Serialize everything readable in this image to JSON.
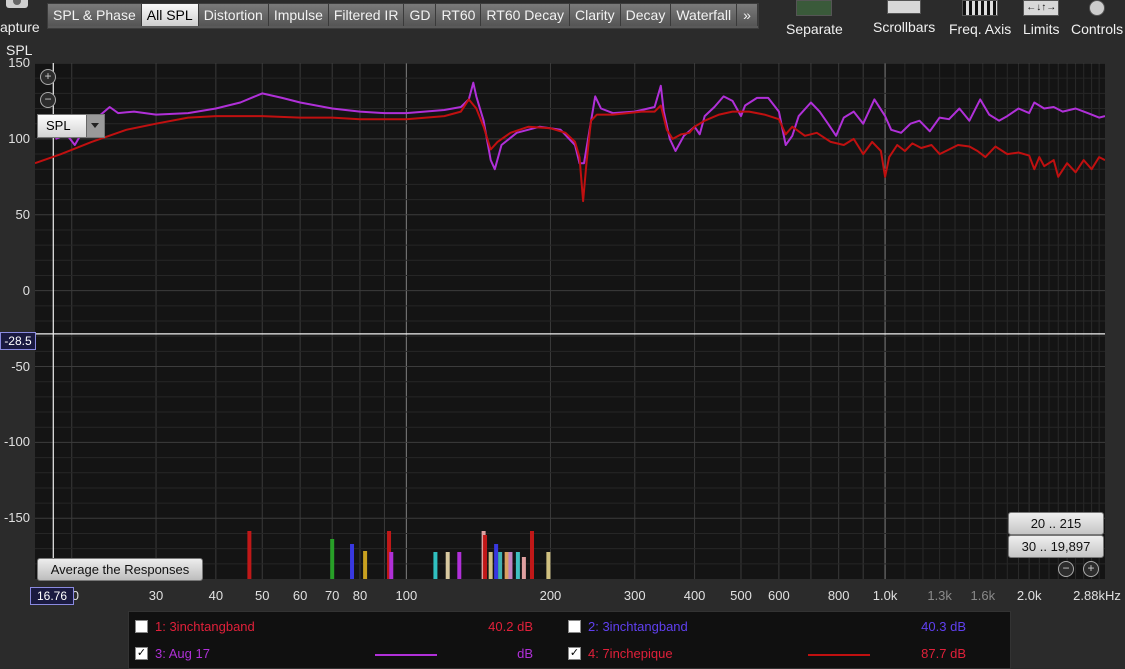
{
  "capture": {
    "label": "apture"
  },
  "tabs": [
    {
      "label": "SPL & Phase",
      "active": false
    },
    {
      "label": "All SPL",
      "active": true
    },
    {
      "label": "Distortion",
      "active": false
    },
    {
      "label": "Impulse",
      "active": false
    },
    {
      "label": "Filtered IR",
      "active": false
    },
    {
      "label": "GD",
      "active": false
    },
    {
      "label": "RT60",
      "active": false
    },
    {
      "label": "RT60 Decay",
      "active": false
    },
    {
      "label": "Clarity",
      "active": false
    },
    {
      "label": "Decay",
      "active": false
    },
    {
      "label": "Waterfall",
      "active": false
    },
    {
      "label": "»",
      "active": false
    }
  ],
  "toolbar": {
    "separate": "Separate",
    "scrollbars": "Scrollbars",
    "freq_axis": "Freq. Axis",
    "limits": "Limits",
    "controls": "Controls"
  },
  "graph": {
    "y_axis_label": "SPL",
    "y_ticks": [
      "150",
      "100",
      "50",
      "0",
      "-50",
      "-100",
      "-150"
    ],
    "y_cursor": "-28.5",
    "x_cursor": "16.76",
    "x_ticks": [
      {
        "label": "20",
        "dim": false
      },
      {
        "label": "30",
        "dim": false
      },
      {
        "label": "40",
        "dim": false
      },
      {
        "label": "50",
        "dim": false
      },
      {
        "label": "60",
        "dim": false
      },
      {
        "label": "70",
        "dim": false
      },
      {
        "label": "80",
        "dim": false
      },
      {
        "label": "100",
        "dim": false
      },
      {
        "label": "200",
        "dim": false
      },
      {
        "label": "300",
        "dim": false
      },
      {
        "label": "400",
        "dim": false
      },
      {
        "label": "500",
        "dim": false
      },
      {
        "label": "600",
        "dim": false
      },
      {
        "label": "800",
        "dim": false
      },
      {
        "label": "1.0k",
        "dim": false
      },
      {
        "label": "1.3k",
        "dim": true
      },
      {
        "label": "1.6k",
        "dim": true
      },
      {
        "label": "2.0k",
        "dim": false
      },
      {
        "label": "2.88kHz",
        "dim": false
      }
    ],
    "spl_select": "SPL",
    "average_button": "Average the Responses",
    "range_buttons": [
      "20 .. 215",
      "30 .. 19,897"
    ]
  },
  "chart_data": {
    "type": "line",
    "ylabel": "SPL",
    "xlabel": "",
    "x_scale": "log",
    "xlim": [
      16.76,
      2880
    ],
    "ylim": [
      -190,
      150
    ],
    "grid": true,
    "series": [
      {
        "name": "3: Aug 17",
        "color": "#b030d8",
        "points": [
          [
            18.5,
            100
          ],
          [
            19.5,
            103
          ],
          [
            20.3,
            96
          ],
          [
            21,
            104
          ],
          [
            22,
            112
          ],
          [
            23,
            116
          ],
          [
            24,
            121
          ],
          [
            25,
            117
          ],
          [
            27,
            118
          ],
          [
            30,
            116
          ],
          [
            35,
            117
          ],
          [
            40,
            120
          ],
          [
            45,
            124
          ],
          [
            50,
            130
          ],
          [
            55,
            127
          ],
          [
            60,
            124
          ],
          [
            70,
            120
          ],
          [
            80,
            118
          ],
          [
            90,
            117
          ],
          [
            100,
            117
          ],
          [
            120,
            119
          ],
          [
            130,
            121
          ],
          [
            135,
            126
          ],
          [
            138,
            137
          ],
          [
            140,
            128
          ],
          [
            145,
            112
          ],
          [
            150,
            86
          ],
          [
            153,
            80
          ],
          [
            158,
            96
          ],
          [
            170,
            104
          ],
          [
            190,
            108
          ],
          [
            210,
            106
          ],
          [
            225,
            96
          ],
          [
            230,
            84
          ],
          [
            235,
            84
          ],
          [
            242,
            108
          ],
          [
            248,
            128
          ],
          [
            255,
            120
          ],
          [
            270,
            117
          ],
          [
            300,
            118
          ],
          [
            330,
            121
          ],
          [
            340,
            135
          ],
          [
            345,
            118
          ],
          [
            355,
            100
          ],
          [
            365,
            92
          ],
          [
            380,
            102
          ],
          [
            400,
            108
          ],
          [
            410,
            103
          ],
          [
            420,
            115
          ],
          [
            440,
            121
          ],
          [
            460,
            128
          ],
          [
            480,
            125
          ],
          [
            500,
            115
          ],
          [
            510,
            122
          ],
          [
            540,
            127
          ],
          [
            570,
            127
          ],
          [
            600,
            118
          ],
          [
            620,
            96
          ],
          [
            640,
            102
          ],
          [
            660,
            115
          ],
          [
            700,
            124
          ],
          [
            730,
            118
          ],
          [
            760,
            110
          ],
          [
            790,
            102
          ],
          [
            820,
            114
          ],
          [
            860,
            118
          ],
          [
            900,
            110
          ],
          [
            950,
            126
          ],
          [
            1000,
            115
          ],
          [
            1030,
            106
          ],
          [
            1080,
            104
          ],
          [
            1130,
            110
          ],
          [
            1180,
            112
          ],
          [
            1240,
            105
          ],
          [
            1300,
            114
          ],
          [
            1360,
            113
          ],
          [
            1430,
            120
          ],
          [
            1500,
            112
          ],
          [
            1580,
            126
          ],
          [
            1650,
            116
          ],
          [
            1730,
            112
          ],
          [
            1800,
            115
          ],
          [
            1900,
            120
          ],
          [
            2000,
            117
          ],
          [
            2050,
            124
          ],
          [
            2150,
            120
          ],
          [
            2250,
            121
          ],
          [
            2350,
            118
          ],
          [
            2500,
            120
          ],
          [
            2650,
            117
          ],
          [
            2800,
            114
          ],
          [
            2880,
            115
          ]
        ]
      },
      {
        "name": "4: 7inchepique",
        "color": "#c01010",
        "points": [
          [
            16.76,
            84
          ],
          [
            19,
            90
          ],
          [
            22,
            98
          ],
          [
            26,
            106
          ],
          [
            30,
            110
          ],
          [
            35,
            114
          ],
          [
            40,
            115
          ],
          [
            50,
            115
          ],
          [
            60,
            114
          ],
          [
            70,
            114
          ],
          [
            80,
            113
          ],
          [
            90,
            113
          ],
          [
            100,
            113
          ],
          [
            110,
            114
          ],
          [
            120,
            115
          ],
          [
            130,
            118
          ],
          [
            135,
            126
          ],
          [
            140,
            120
          ],
          [
            145,
            108
          ],
          [
            150,
            93
          ],
          [
            155,
            98
          ],
          [
            165,
            104
          ],
          [
            180,
            108
          ],
          [
            200,
            107
          ],
          [
            215,
            104
          ],
          [
            225,
            98
          ],
          [
            230,
            88
          ],
          [
            234,
            59
          ],
          [
            238,
            85
          ],
          [
            243,
            112
          ],
          [
            250,
            116
          ],
          [
            270,
            116
          ],
          [
            290,
            117
          ],
          [
            310,
            118
          ],
          [
            330,
            118
          ],
          [
            340,
            122
          ],
          [
            350,
            106
          ],
          [
            360,
            100
          ],
          [
            375,
            103
          ],
          [
            390,
            104
          ],
          [
            400,
            108
          ],
          [
            420,
            112
          ],
          [
            450,
            116
          ],
          [
            480,
            118
          ],
          [
            520,
            118
          ],
          [
            560,
            116
          ],
          [
            600,
            113
          ],
          [
            620,
            103
          ],
          [
            640,
            108
          ],
          [
            680,
            102
          ],
          [
            720,
            104
          ],
          [
            770,
            98
          ],
          [
            820,
            96
          ],
          [
            860,
            100
          ],
          [
            900,
            90
          ],
          [
            940,
            98
          ],
          [
            980,
            92
          ],
          [
            1000,
            75
          ],
          [
            1020,
            88
          ],
          [
            1060,
            96
          ],
          [
            1100,
            92
          ],
          [
            1140,
            97
          ],
          [
            1190,
            94
          ],
          [
            1250,
            96
          ],
          [
            1300,
            90
          ],
          [
            1360,
            93
          ],
          [
            1420,
            96
          ],
          [
            1500,
            95
          ],
          [
            1560,
            92
          ],
          [
            1620,
            88
          ],
          [
            1700,
            95
          ],
          [
            1800,
            90
          ],
          [
            1900,
            91
          ],
          [
            2000,
            89
          ],
          [
            2050,
            80
          ],
          [
            2100,
            88
          ],
          [
            2150,
            82
          ],
          [
            2250,
            86
          ],
          [
            2300,
            75
          ],
          [
            2400,
            84
          ],
          [
            2500,
            78
          ],
          [
            2600,
            86
          ],
          [
            2700,
            80
          ],
          [
            2800,
            88
          ],
          [
            2880,
            86
          ]
        ]
      }
    ]
  },
  "legend": [
    {
      "index_name": "1: 3inchtangband",
      "db": "40.2 dB",
      "checked": false,
      "color": "#e0203a",
      "line": false
    },
    {
      "index_name": "2: 3inchtangband",
      "db": "40.3 dB",
      "checked": false,
      "color": "#6040f0",
      "line": false
    },
    {
      "index_name": "3: Aug 17",
      "db": "dB",
      "checked": true,
      "color": "#b030d8",
      "line": true
    },
    {
      "index_name": "4: 7inchepique",
      "db": "87.7 dB",
      "checked": true,
      "color": "#e0203a",
      "line": true
    }
  ],
  "markers": {
    "colors": [
      "#c01818",
      "#28a028",
      "#3838e0",
      "#c8a020",
      "#c01818",
      "#b030d8",
      "#30c0c0",
      "#d8c8a0",
      "#b030d8",
      "#e0a0a0",
      "#c01818",
      "#d0c080",
      "#3838e0",
      "#40b0b0",
      "#d8a060",
      "#c080c0",
      "#40c0c0",
      "#e0a0a0",
      "#c01818",
      "#d0c080"
    ],
    "freqs": [
      47,
      70,
      77,
      82,
      92,
      93,
      115,
      122,
      129,
      145,
      146,
      150,
      154,
      157,
      162,
      165,
      171,
      176,
      183,
      198
    ],
    "heights": [
      48,
      40,
      35,
      28,
      48,
      27,
      27,
      27,
      27,
      48,
      44,
      27,
      35,
      27,
      27,
      27,
      27,
      22,
      48,
      27
    ]
  }
}
